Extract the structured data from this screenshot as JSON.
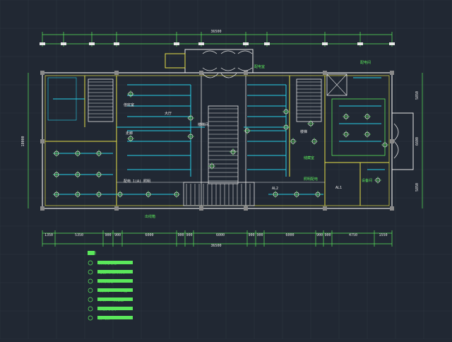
{
  "drawing": {
    "background": "#212833",
    "grid_color": "#2d3440",
    "colors": {
      "wall": "#e6e6e6",
      "wall_yellow": "#e8e048",
      "dimension": "#5be85b",
      "wiring": "#28d0e8",
      "fixture": "#e8e8e8",
      "annotation": "#5be85b",
      "stair": "#e6e6e6"
    },
    "top_total_dimension": "36500",
    "bottom_total_dimension": "36500",
    "left_dimension": "18000",
    "bottom_dimensions": [
      "1350",
      "5350",
      "900",
      "900",
      "6000",
      "900",
      "900",
      "6000",
      "900",
      "900",
      "6000",
      "900",
      "900",
      "4750",
      "1550"
    ],
    "right_dimensions": [
      "5850",
      "6600",
      "5850"
    ]
  },
  "labels": {
    "switch_room": "配电间",
    "room_a": "值班室",
    "room_b": "大厅",
    "room_c": "楼梯间",
    "room_d": "走廊",
    "room_e": "配电室",
    "room_f": "储藏室",
    "room_g": "楼梯",
    "room_h": "设备间",
    "note_a": "配电 1(A) 照明",
    "note_b": "出线箱",
    "note_c": "AL1",
    "note_d": "照明配电",
    "note_e": "AL2"
  },
  "legend": {
    "title": "图例",
    "items": [
      {
        "symbol": "distribution-box",
        "text": "照明配电箱"
      },
      {
        "symbol": "switch",
        "text": "暗装 单联 开关"
      },
      {
        "symbol": "line",
        "text": "照明线路"
      },
      {
        "symbol": "ceiling-lamp",
        "text": "吸顶灯 40W 节能"
      },
      {
        "symbol": "outlet",
        "text": "单相二三极插座"
      },
      {
        "symbol": "double-lamp",
        "text": "双管荧光灯"
      },
      {
        "symbol": "exhaust-fan",
        "text": "排气扇"
      }
    ]
  }
}
